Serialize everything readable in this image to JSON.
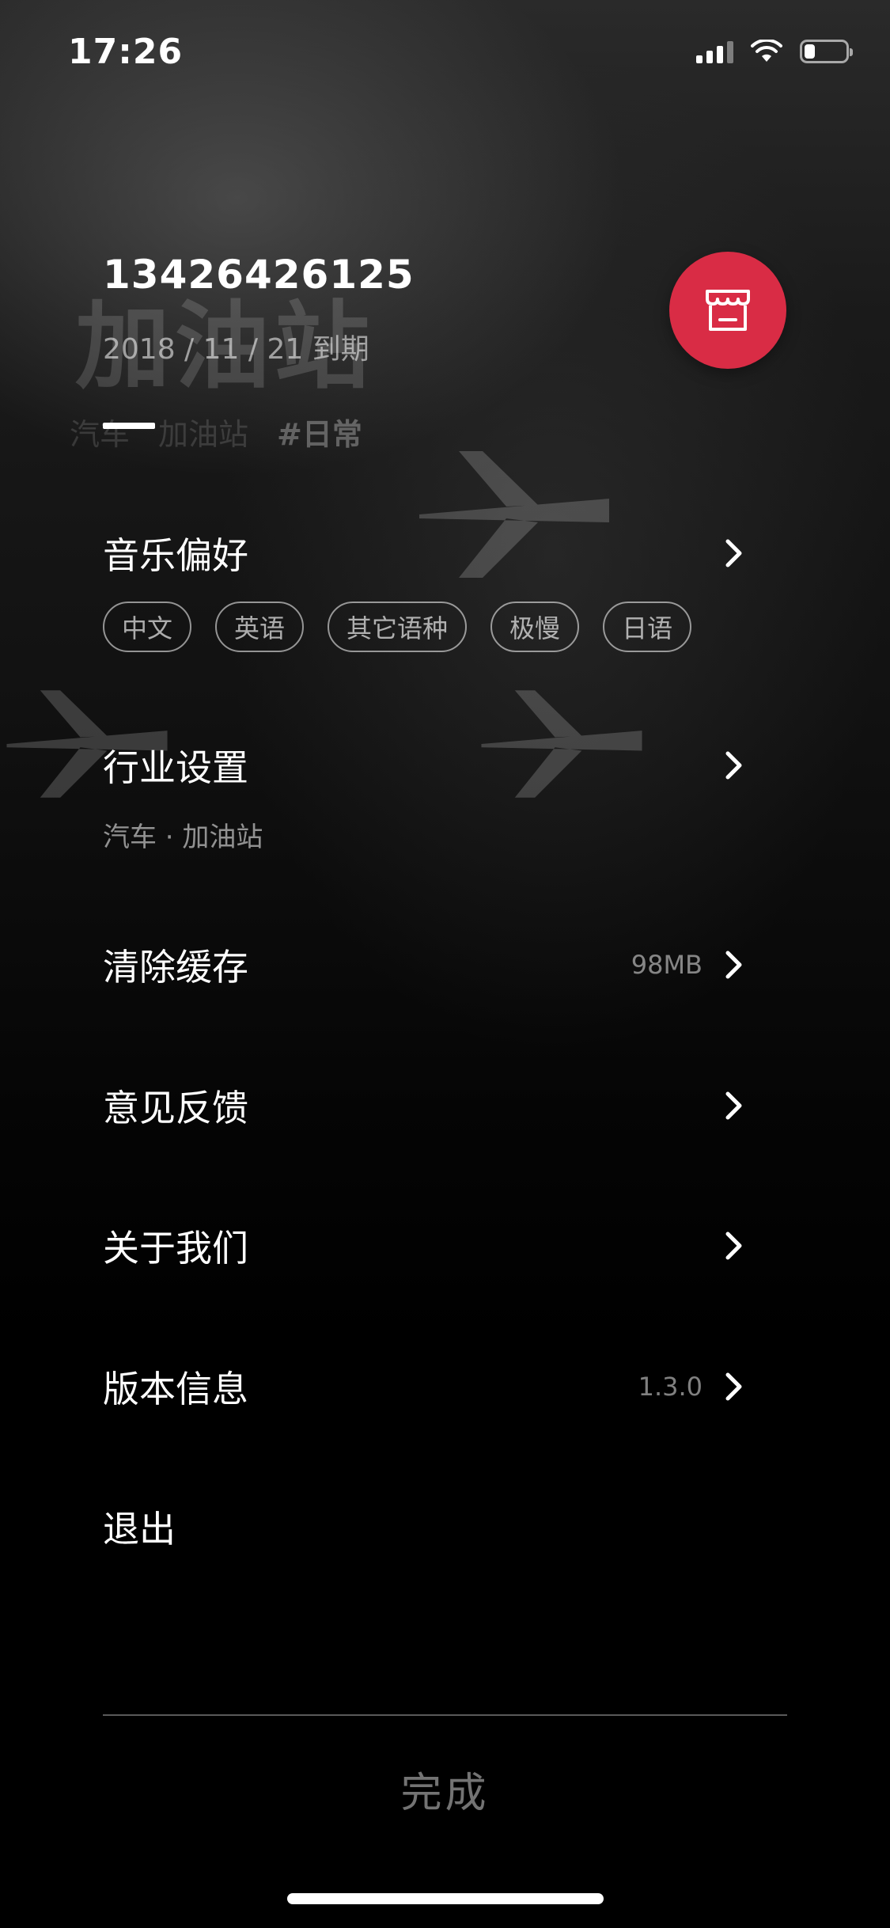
{
  "status_bar": {
    "time": "17:26",
    "battery_level": 0.25
  },
  "header": {
    "background_title": "加油站",
    "phone": "13426426125",
    "expire": "2018 / 11 / 21 到期",
    "tabs": [
      "汽车",
      "加油站",
      "#日常"
    ],
    "store_icon": "store-icon",
    "accent_color": "#d92c45"
  },
  "menu": {
    "music": {
      "label": "音乐偏好",
      "chips": [
        "中文",
        "英语",
        "其它语种",
        "极慢",
        "日语"
      ]
    },
    "industry": {
      "label": "行业设置",
      "value": "汽车 · 加油站"
    },
    "cache": {
      "label": "清除缓存",
      "value": "98MB"
    },
    "feedback": {
      "label": "意见反馈"
    },
    "about": {
      "label": "关于我们"
    },
    "version": {
      "label": "版本信息",
      "value": "1.3.0"
    },
    "logout": {
      "label": "退出"
    }
  },
  "footer": {
    "done_label": "完成"
  }
}
